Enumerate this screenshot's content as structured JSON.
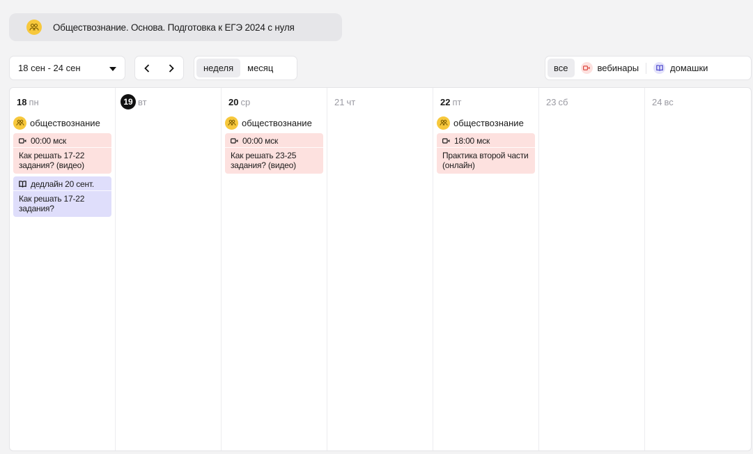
{
  "course": {
    "title": "Обществознание. Основа. Подготовка к ЕГЭ 2024 с нуля",
    "icon": "people-icon"
  },
  "toolbar": {
    "range_label": "18 сен - 24 сен",
    "view_week": "неделя",
    "view_month": "месяц",
    "filter_all": "все",
    "filter_webinars": "вебинары",
    "filter_homework": "домашки"
  },
  "days": [
    {
      "num": "18",
      "weekday": "пн",
      "subject": "обществознание",
      "webinar": {
        "meta": "00:00 мск",
        "title": "Как решать 17-22 задания? (видео)"
      },
      "homework": {
        "meta": "дедлайн 20 сент.",
        "title": "Как решать 17-22 задания?"
      }
    },
    {
      "num": "19",
      "weekday": "вт"
    },
    {
      "num": "20",
      "weekday": "ср",
      "subject": "обществознание",
      "webinar": {
        "meta": "00:00 мск",
        "title": "Как решать 23-25 задания? (видео)"
      }
    },
    {
      "num": "21",
      "weekday": "чт"
    },
    {
      "num": "22",
      "weekday": "пт",
      "subject": "обществознание",
      "webinar": {
        "meta": "18:00 мск",
        "title": "Практика второй части (онлайн)"
      }
    },
    {
      "num": "23",
      "weekday": "сб"
    },
    {
      "num": "24",
      "weekday": "вс"
    }
  ],
  "colors": {
    "today": "#111111",
    "webinar_bg": "#fde1df",
    "homework_bg": "#dfdefb",
    "subject_icon": "#f7c83c"
  }
}
